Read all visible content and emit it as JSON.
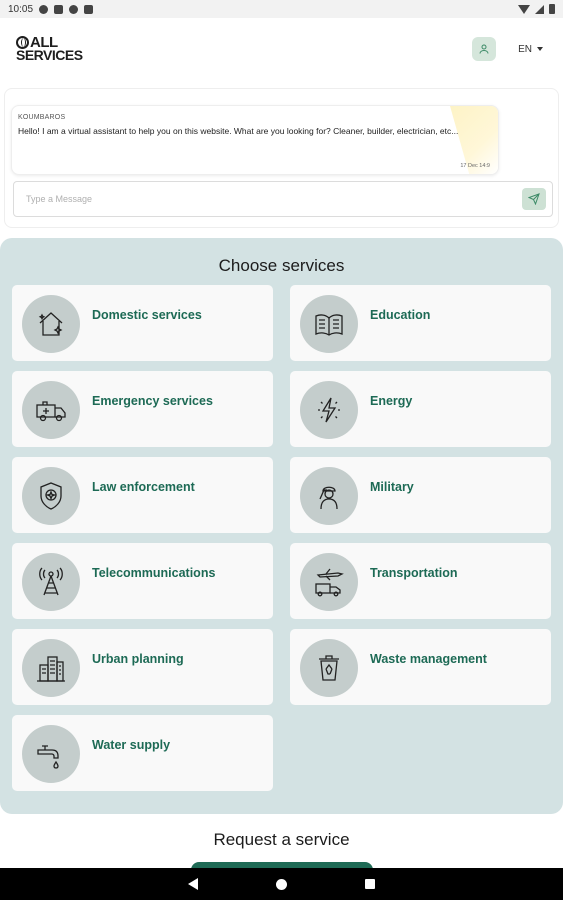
{
  "status_bar": {
    "time": "10:05"
  },
  "header": {
    "logo_line1": "ALL",
    "logo_line2": "SERVICES",
    "language": "EN"
  },
  "chat": {
    "sender": "KOUMBAROS",
    "message": "Hello! I am a virtual assistant to help you on this website. What are you looking for? Cleaner, builder, electrician, etc...",
    "time": "17 Dec 14:9",
    "input_placeholder": "Type a Message"
  },
  "services": {
    "title": "Choose services",
    "items": [
      {
        "label": "Domestic services",
        "icon": "house-sparkle-icon"
      },
      {
        "label": "Education",
        "icon": "book-icon"
      },
      {
        "label": "Emergency services",
        "icon": "ambulance-icon"
      },
      {
        "label": "Energy",
        "icon": "lightning-icon"
      },
      {
        "label": "Law enforcement",
        "icon": "police-badge-icon"
      },
      {
        "label": "Military",
        "icon": "soldier-salute-icon"
      },
      {
        "label": "Telecommunications",
        "icon": "antenna-tower-icon"
      },
      {
        "label": "Transportation",
        "icon": "transport-icon"
      },
      {
        "label": "Urban planning",
        "icon": "city-buildings-icon"
      },
      {
        "label": "Waste management",
        "icon": "recycle-bin-icon"
      },
      {
        "label": "Water supply",
        "icon": "water-tap-icon"
      }
    ]
  },
  "request": {
    "title": "Request a service"
  },
  "colors": {
    "accent_green": "#1d6a55",
    "services_bg": "#d3e2e3",
    "card_bg": "#f9f9f9",
    "icon_circle": "#c4cdcc"
  }
}
